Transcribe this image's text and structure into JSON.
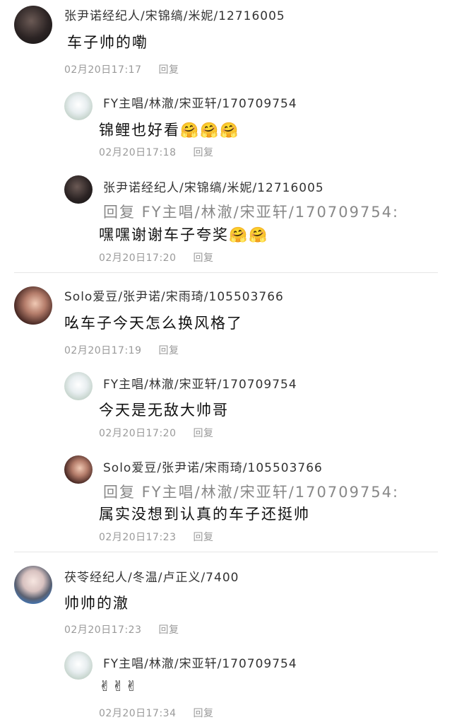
{
  "threads": [
    {
      "main": {
        "avatar_icon": "user-avatar-dark",
        "name": "张尹诺经纪人/宋锦缟/米妮/12716005",
        "text": "车子帅的嘞",
        "time": "02月20日17:17",
        "reply_label": "回复"
      },
      "replies": [
        {
          "avatar_icon": "user-avatar-silver",
          "name": "FY主唱/林澈/宋亚轩/170709754",
          "text": "锦鲤也好看🤗🤗🤗",
          "time": "02月20日17:18",
          "reply_label": "回复"
        },
        {
          "avatar_icon": "user-avatar-dark",
          "name": "张尹诺经纪人/宋锦缟/米妮/12716005",
          "reply_prefix": "回复 FY主唱/林澈/宋亚轩/170709754:",
          "text": "嘿嘿谢谢车子夸奖🤗🤗",
          "time": "02月20日17:20",
          "reply_label": "回复"
        }
      ]
    },
    {
      "main": {
        "avatar_icon": "user-avatar-girl",
        "name": "Solo爱豆/张尹诺/宋雨琦/105503766",
        "text": "吆车子今天怎么换风格了",
        "time": "02月20日17:19",
        "reply_label": "回复"
      },
      "replies": [
        {
          "avatar_icon": "user-avatar-silver",
          "name": "FY主唱/林澈/宋亚轩/170709754",
          "text": "今天是无敌大帅哥",
          "time": "02月20日17:20",
          "reply_label": "回复"
        },
        {
          "avatar_icon": "user-avatar-girl",
          "name": "Solo爱豆/张尹诺/宋雨琦/105503766",
          "reply_prefix": "回复 FY主唱/林澈/宋亚轩/170709754:",
          "text": "属实没想到认真的车子还挺帅",
          "time": "02月20日17:23",
          "reply_label": "回复"
        }
      ]
    },
    {
      "main": {
        "avatar_icon": "user-avatar-blue",
        "name": "茯苓经纪人/冬温/卢正义/7400",
        "text": "帅帅的澈",
        "time": "02月20日17:23",
        "reply_label": "回复"
      },
      "replies": [
        {
          "avatar_icon": "user-avatar-silver",
          "name": "FY主唱/林澈/宋亚轩/170709754",
          "text": "✌✌✌",
          "time": "02月20日17:34",
          "reply_label": "回复"
        }
      ]
    }
  ]
}
